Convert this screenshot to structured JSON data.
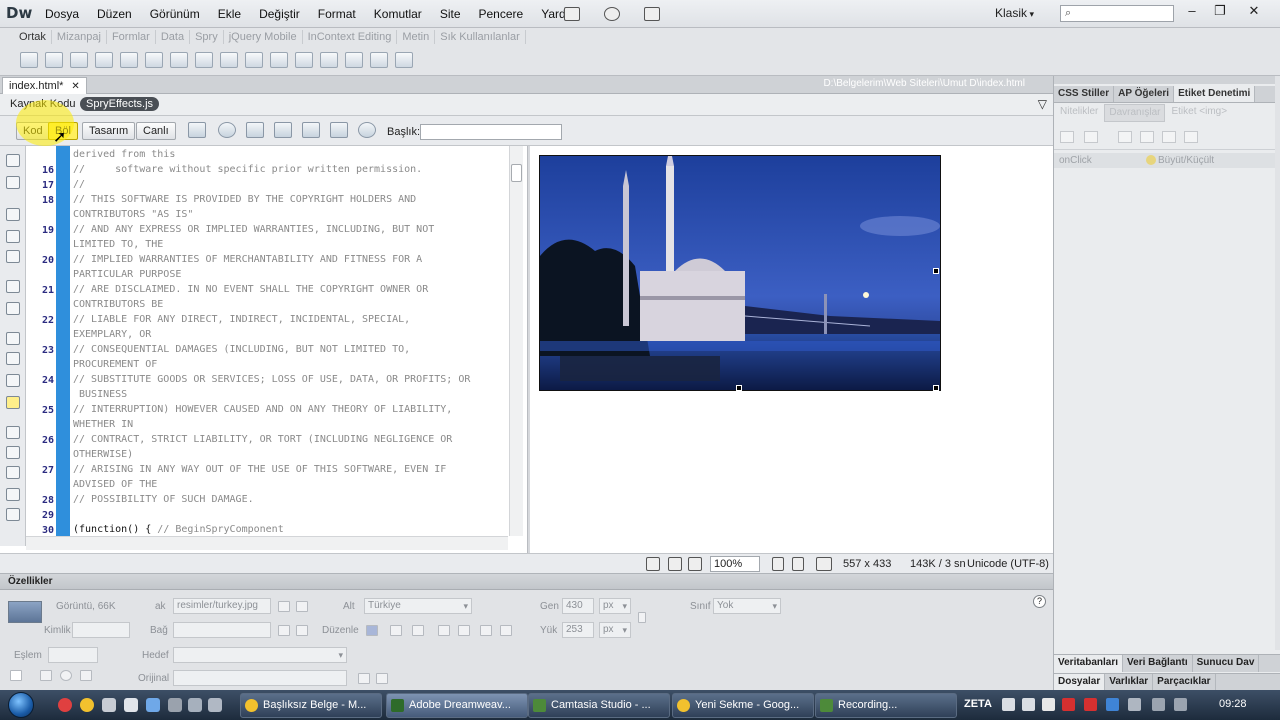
{
  "app": {
    "logo": "Dw"
  },
  "menu": [
    "Dosya",
    "Düzen",
    "Görünüm",
    "Ekle",
    "Değiştir",
    "Format",
    "Komutlar",
    "Site",
    "Pencere",
    "Yardım"
  ],
  "workspace": "Klasik",
  "insert_tabs": [
    "Ortak",
    "Mizanpaj",
    "Formlar",
    "Data",
    "Spry",
    "jQuery Mobile",
    "InContext Editing",
    "Metin",
    "Sık Kullanılanlar"
  ],
  "document": {
    "tab": "index.html*",
    "path": "D:\\Belgelerim\\Web Siteleri\\Umut D\\index.html",
    "source_code": "Kaynak Kodu",
    "related_file": "SpryEffects.js",
    "views": [
      "Kod",
      "Böl",
      "Tasarım",
      "Canlı"
    ],
    "title_label": "Başlık:",
    "title_value": ""
  },
  "code": {
    "line_numbers": [
      "16",
      "17",
      "18",
      "19",
      "20",
      "21",
      "22",
      "23",
      "24",
      "25",
      "26",
      "27",
      "28",
      "29",
      "30"
    ],
    "lines": [
      "derived from this",
      "//     software without specific prior written permission.",
      "//",
      "// THIS SOFTWARE IS PROVIDED BY THE COPYRIGHT HOLDERS AND",
      "CONTRIBUTORS \"AS IS\"",
      "// AND ANY EXPRESS OR IMPLIED WARRANTIES, INCLUDING, BUT NOT",
      "LIMITED TO, THE",
      "// IMPLIED WARRANTIES OF MERCHANTABILITY AND FITNESS FOR A",
      "PARTICULAR PURPOSE",
      "// ARE DISCLAIMED. IN NO EVENT SHALL THE COPYRIGHT OWNER OR",
      "CONTRIBUTORS BE",
      "// LIABLE FOR ANY DIRECT, INDIRECT, INCIDENTAL, SPECIAL,",
      "EXEMPLARY, OR",
      "// CONSEQUENTIAL DAMAGES (INCLUDING, BUT NOT LIMITED TO,",
      "PROCUREMENT OF",
      "// SUBSTITUTE GOODS OR SERVICES; LOSS OF USE, DATA, OR PROFITS; OR",
      " BUSINESS",
      "// INTERRUPTION) HOWEVER CAUSED AND ON ANY THEORY OF LIABILITY,",
      "WHETHER IN",
      "// CONTRACT, STRICT LIABILITY, OR TORT (INCLUDING NEGLIGENCE OR",
      "OTHERWISE)",
      "// ARISING IN ANY WAY OUT OF THE USE OF THIS SOFTWARE, EVEN IF",
      "ADVISED OF THE",
      "// POSSIBILITY OF SUCH DAMAGE.",
      "",
      "(function() { ",
      "// BeginSpryComponent"
    ]
  },
  "status": {
    "zoom": "100%",
    "dimensions": "557 x 433",
    "size": "143K / 3 sn",
    "encoding": "Unicode (UTF-8)"
  },
  "properties": {
    "title": "Özellikler",
    "image_label": "Görüntü, 66K",
    "kaynak_label": "ak",
    "kaynak_value": "resimler/turkey.jpg",
    "kimlik_label": "Kimlik",
    "bag_label": "Bağ",
    "alt_label": "Alt",
    "alt_value": "Türkiye",
    "duzenle_label": "Düzenle",
    "gen_label": "Gen",
    "gen_value": "430",
    "yuk_label": "Yük",
    "yuk_value": "253",
    "unit": "px",
    "sinif_label": "Sınıf",
    "sinif_value": "Yok",
    "eslem_label": "Eşlem",
    "hedef_label": "Hedef",
    "orijinal_label": "Orijinal",
    "help": "?"
  },
  "right_panel": {
    "tabs": [
      "CSS Stiller",
      "AP Öğeleri",
      "Etiket Denetimi"
    ],
    "subtabs": [
      "Nitelikler",
      "Davranışlar",
      "Etiket <img>"
    ],
    "behavior": {
      "event": "onClick",
      "action": "Büyüt/Küçült"
    },
    "bottom_tabs_1": [
      "Veritabanları",
      "Veri Bağlantı",
      "Sunucu Dav"
    ],
    "bottom_tabs_2": [
      "Dosyalar",
      "Varlıklar",
      "Parçacıklar"
    ]
  },
  "taskbar": {
    "tasks": [
      "Başlıksız Belge - M...",
      "Adobe Dreamweav...",
      "Camtasia Studio - ...",
      "Yeni Sekme - Goog...",
      "Recording..."
    ],
    "tray_label": "ZETA",
    "clock": "09:28"
  }
}
